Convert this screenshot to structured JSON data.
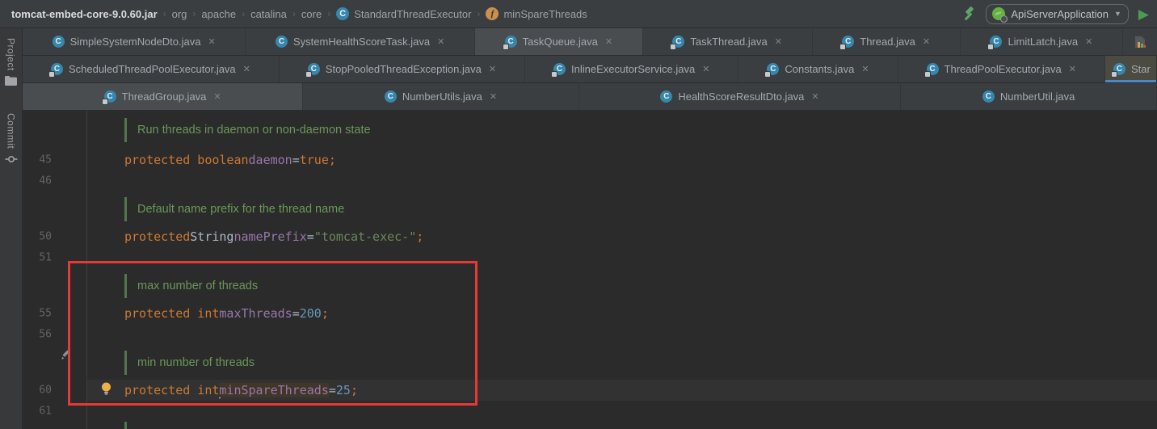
{
  "theme": {
    "editor_bg": "#2B2B2B",
    "panel_bg": "#3B3E40",
    "active_tab_underline": "#4A88C7",
    "keyword_color": "#CC7832",
    "field_color": "#9876AA",
    "string_color": "#6A8759",
    "number_color": "#6897BB",
    "comment_color": "#699758",
    "annotation_color": "#E53935",
    "run_green": "#499C54"
  },
  "breadcrumb": {
    "separator": "›",
    "segments": [
      {
        "label": "tomcat-embed-core-9.0.60.jar",
        "style": "bold"
      },
      {
        "label": "org"
      },
      {
        "label": "apache"
      },
      {
        "label": "catalina"
      },
      {
        "label": "core"
      },
      {
        "label": "StandardThreadExecutor",
        "icon": "class"
      },
      {
        "label": "minSpareThreads",
        "icon": "field"
      }
    ],
    "class_glyph": "C",
    "field_glyph": "f"
  },
  "toolbar": {
    "run_config": "ApiServerApplication",
    "dropdown_arrow": "▼",
    "play_glyph": "▶"
  },
  "tool_windows": {
    "project_label": "Project",
    "commit_label": "Commit"
  },
  "tabs": {
    "class_glyph": "C",
    "close_glyph": "✕",
    "rows": [
      [
        {
          "label": "SimpleSystemNodeDto.java",
          "lock": false,
          "close": true,
          "variant": "normal"
        },
        {
          "label": "SystemHealthScoreTask.java",
          "lock": false,
          "close": true,
          "variant": "normal"
        },
        {
          "label": "TaskQueue.java",
          "lock": true,
          "close": true,
          "variant": "light"
        },
        {
          "label": "TaskThread.java",
          "lock": true,
          "close": true,
          "variant": "normal"
        },
        {
          "label": "Thread.java",
          "lock": true,
          "close": true,
          "variant": "normal"
        },
        {
          "label": "LimitLatch.java",
          "lock": true,
          "close": true,
          "variant": "normal"
        }
      ],
      [
        {
          "label": "ScheduledThreadPoolExecutor.java",
          "lock": true,
          "close": true,
          "variant": "normal"
        },
        {
          "label": "StopPooledThreadException.java",
          "lock": true,
          "close": true,
          "variant": "normal"
        },
        {
          "label": "InlineExecutorService.java",
          "lock": true,
          "close": true,
          "variant": "normal"
        },
        {
          "label": "Constants.java",
          "lock": true,
          "close": true,
          "variant": "normal"
        },
        {
          "label": "ThreadPoolExecutor.java",
          "lock": true,
          "close": true,
          "variant": "normal"
        },
        {
          "label": "Star",
          "lock": true,
          "close": false,
          "variant": "active"
        }
      ],
      [
        {
          "label": "ThreadGroup.java",
          "lock": true,
          "close": true,
          "variant": "light"
        },
        {
          "label": "NumberUtils.java",
          "lock": false,
          "close": true,
          "variant": "normal"
        },
        {
          "label": "HealthScoreResultDto.java",
          "lock": false,
          "close": true,
          "variant": "normal"
        },
        {
          "label": "NumberUtil.java",
          "lock": false,
          "close": false,
          "variant": "normal"
        }
      ]
    ]
  },
  "editor": {
    "rows": [
      {
        "type": "comment",
        "lead": true,
        "text": "Run threads in daemon or non-daemon state"
      },
      {
        "type": "code",
        "num": "45",
        "tokens": [
          {
            "t": "protected boolean ",
            "c": "kw"
          },
          {
            "t": "daemon",
            "c": "field"
          },
          {
            "t": " = ",
            "c": "plain"
          },
          {
            "t": "true;",
            "c": "kw"
          }
        ]
      },
      {
        "type": "blank",
        "num": "46"
      },
      {
        "type": "comment",
        "text": "Default name prefix for the thread name"
      },
      {
        "type": "code",
        "num": "50",
        "tokens": [
          {
            "t": "protected ",
            "c": "kw"
          },
          {
            "t": "String ",
            "c": "plain"
          },
          {
            "t": "namePrefix",
            "c": "field"
          },
          {
            "t": " = ",
            "c": "plain"
          },
          {
            "t": "\"tomcat-exec-\"",
            "c": "str"
          },
          {
            "t": ";",
            "c": "kw"
          }
        ]
      },
      {
        "type": "blank",
        "num": "51"
      },
      {
        "type": "comment",
        "text": "max number of threads"
      },
      {
        "type": "code",
        "num": "55",
        "tokens": [
          {
            "t": "protected int ",
            "c": "kw"
          },
          {
            "t": "maxThreads",
            "c": "field"
          },
          {
            "t": " = ",
            "c": "plain"
          },
          {
            "t": "200",
            "c": "num"
          },
          {
            "t": ";",
            "c": "kw"
          }
        ]
      },
      {
        "type": "blank",
        "num": "56"
      },
      {
        "type": "comment",
        "text": "min number of threads",
        "pencil": true
      },
      {
        "type": "code",
        "num": "60",
        "current": true,
        "bulb": true,
        "tokens": [
          {
            "t": "protected int ",
            "c": "kw"
          },
          {
            "t": "minSpareThreads",
            "c": "field",
            "hl": true,
            "caretBefore": true
          },
          {
            "t": " = ",
            "c": "plain"
          },
          {
            "t": "25",
            "c": "num"
          },
          {
            "t": ";",
            "c": "kw"
          }
        ]
      },
      {
        "type": "blank",
        "num": "61"
      },
      {
        "type": "stub"
      }
    ]
  }
}
